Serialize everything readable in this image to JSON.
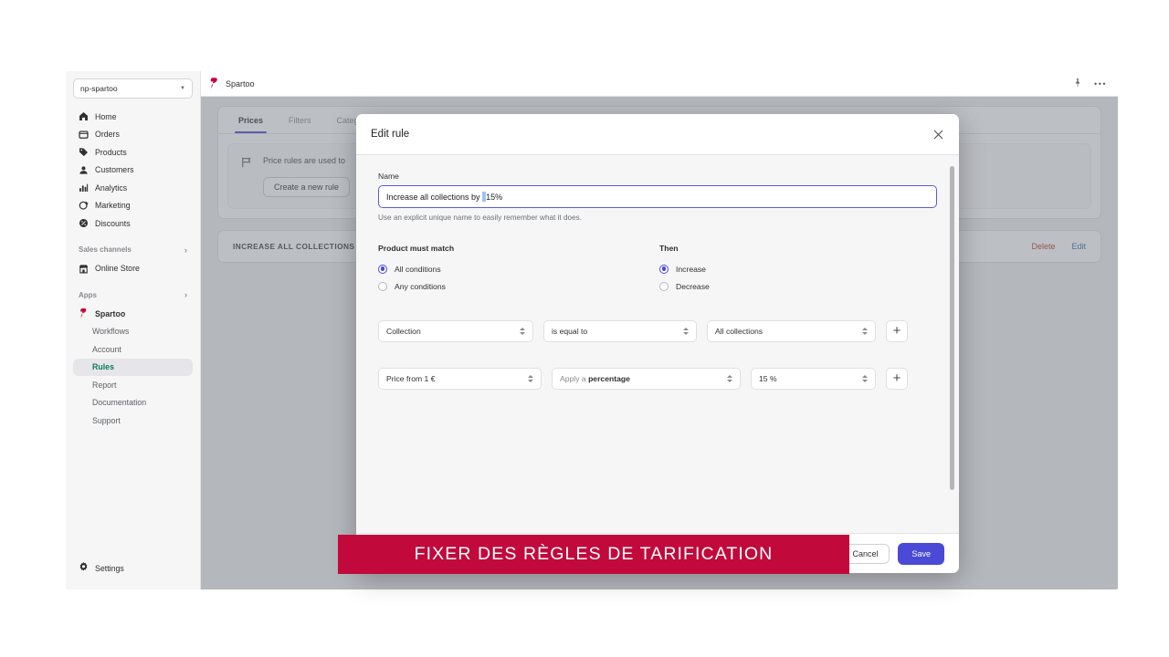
{
  "sidebar": {
    "store_selector": {
      "label": "np-spartoo",
      "caret": "chevron-down-icon"
    },
    "items": [
      {
        "label": "Home",
        "icon": "home-icon"
      },
      {
        "label": "Orders",
        "icon": "orders-icon"
      },
      {
        "label": "Products",
        "icon": "products-tag-icon"
      },
      {
        "label": "Customers",
        "icon": "customers-person-icon"
      },
      {
        "label": "Analytics",
        "icon": "analytics-bars-icon"
      },
      {
        "label": "Marketing",
        "icon": "marketing-megaphone-icon"
      },
      {
        "label": "Discounts",
        "icon": "discounts-icon"
      }
    ],
    "sections": [
      {
        "label": "Sales channels",
        "chevron": "chevron-right-icon"
      },
      {
        "label": "Apps",
        "chevron": "chevron-right-icon"
      }
    ],
    "online_store": {
      "label": "Online Store",
      "icon": "store-icon"
    },
    "app": {
      "label": "Spartoo",
      "icon": "spartoo-logo-icon"
    },
    "sub_items": [
      {
        "label": "Workflows",
        "active": false
      },
      {
        "label": "Account",
        "active": false
      },
      {
        "label": "Rules",
        "active": true
      },
      {
        "label": "Report",
        "active": false
      },
      {
        "label": "Documentation",
        "active": false
      },
      {
        "label": "Support",
        "active": false
      }
    ],
    "settings": {
      "label": "Settings",
      "icon": "gear-icon"
    }
  },
  "topbar": {
    "app_title": "Spartoo",
    "logo": "spartoo-logo-icon",
    "pin_icon": "pin-icon",
    "more_icon": "more-horizontal-icon"
  },
  "main": {
    "tabs": [
      {
        "label": "Prices",
        "active": true
      },
      {
        "label": "Filters",
        "active": false
      },
      {
        "label": "Categ",
        "active": false
      }
    ],
    "info_icon": "price-rule-flag-icon",
    "info_text": "Price rules are used to",
    "create_button": "Create a new rule",
    "rule_row": {
      "title": "INCREASE ALL COLLECTIONS BY",
      "delete_label": "Delete",
      "edit_label": "Edit"
    }
  },
  "modal": {
    "title": "Edit rule",
    "close_icon": "close-icon",
    "name": {
      "label": "Name",
      "value_before_caret": "Increase all collections by ",
      "value_after_caret": "15%",
      "full_value": "Increase all collections by 15%",
      "helper": "Use an explicit unique name to easily remember what it does."
    },
    "match": {
      "title": "Product must match",
      "options": [
        {
          "label": "All conditions",
          "checked": true
        },
        {
          "label": "Any conditions",
          "checked": false
        }
      ]
    },
    "then": {
      "title": "Then",
      "options": [
        {
          "label": "Increase",
          "checked": true
        },
        {
          "label": "Decrease",
          "checked": false
        }
      ]
    },
    "rows": [
      {
        "field": "Collection",
        "operator": "is equal to",
        "value": "All collections",
        "add_label": "+"
      },
      {
        "field": "Price from 1 €",
        "operator_prefix": "Apply a ",
        "operator_bold": "percentage",
        "value": "15 %",
        "add_label": "+"
      }
    ],
    "footer": {
      "cancel_label": "Cancel",
      "save_label": "Save"
    }
  },
  "caption": {
    "text": "FIXER DES RÈGLES DE TARIFICATION",
    "background": "#c2093c",
    "color": "#ffffff"
  },
  "colors": {
    "accent_indigo": "#4a4ad6",
    "active_nav_green": "#0f7a5e",
    "delete_red": "#c0392b",
    "caption_crimson": "#c2093c"
  }
}
